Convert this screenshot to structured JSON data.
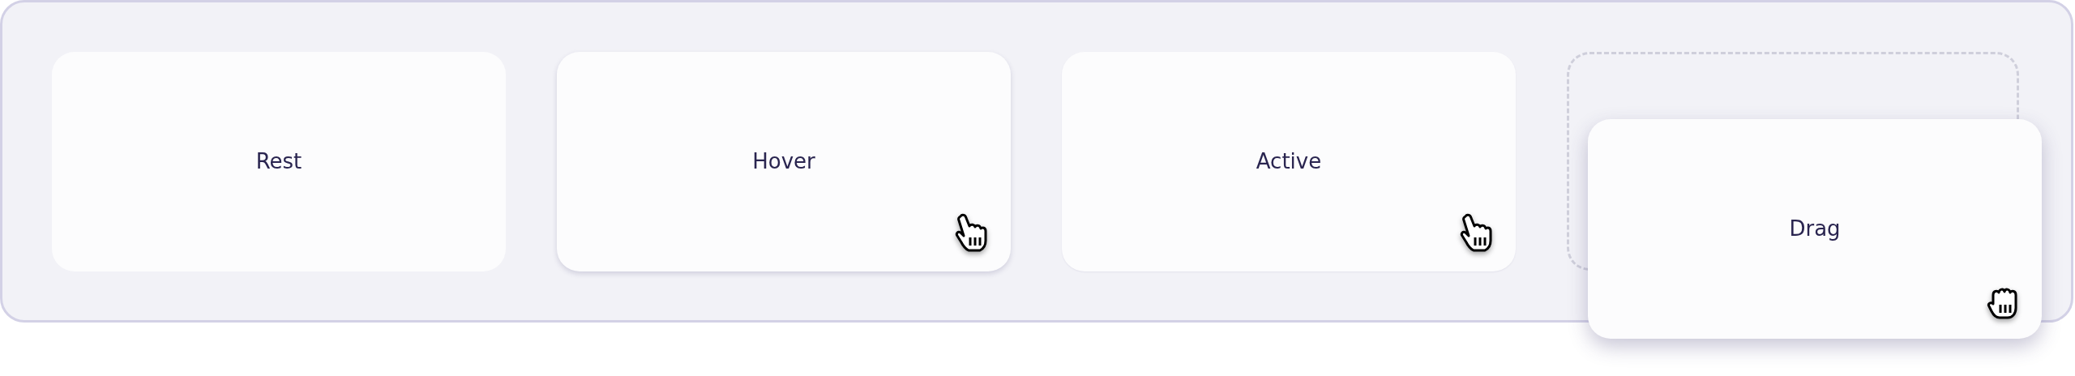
{
  "states": [
    {
      "kind": "rest",
      "label": "Rest"
    },
    {
      "kind": "hover",
      "label": "Hover"
    },
    {
      "kind": "active",
      "label": "Active"
    },
    {
      "kind": "drag",
      "label": "Drag"
    }
  ]
}
